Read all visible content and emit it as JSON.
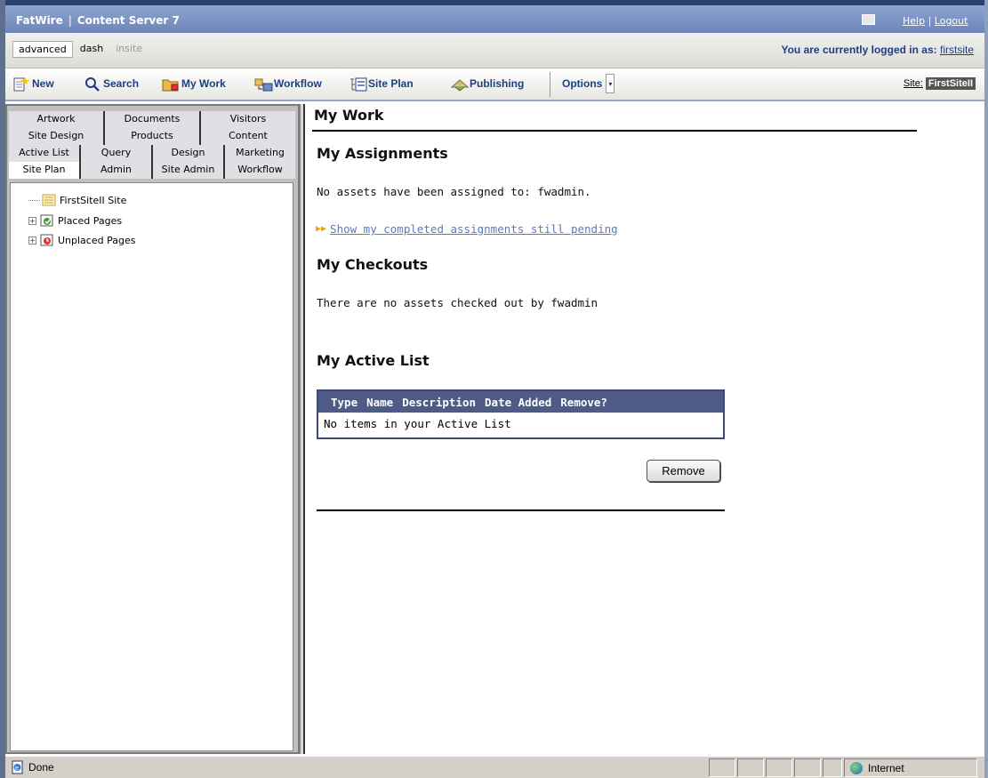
{
  "app": {
    "brand": "FatWire",
    "product": "Content Server 7",
    "help": "Help",
    "logout": "Logout"
  },
  "modes": [
    "advanced",
    "dash",
    "insite"
  ],
  "login": {
    "prefix": "You are currently logged in as:",
    "user": "firstsite"
  },
  "toolbar": {
    "new": "New",
    "search": "Search",
    "my_work": "My Work",
    "workflow": "Workflow",
    "site_plan": "Site Plan",
    "publishing": "Publishing",
    "options": "Options",
    "site_label": "Site:",
    "site_value": "FirstSiteII"
  },
  "left_tabs": [
    [
      "Artwork",
      "Documents",
      "Visitors"
    ],
    [
      "Site Design",
      "Products",
      "Content"
    ],
    [
      "Active List",
      "Query",
      "Design",
      "Marketing"
    ],
    [
      "Site Plan",
      "Admin",
      "Site Admin",
      "Workflow"
    ]
  ],
  "tree": {
    "root": "FirstSiteII Site",
    "placed": "Placed Pages",
    "unplaced": "Unplaced Pages"
  },
  "content": {
    "title": "My Work",
    "assignments_heading": "My Assignments",
    "assignments_text": "No assets have been assigned to: fwadmin.",
    "pending_link": "Show my completed assignments still pending",
    "checkouts_heading": "My Checkouts",
    "checkouts_text": "There are no assets checked out by fwadmin",
    "active_list_heading": "My Active List",
    "table_columns": [
      "Type",
      "Name",
      "Description",
      "Date Added",
      "Remove?"
    ],
    "table_empty": "No items in your Active List",
    "remove_button": "Remove"
  },
  "status": {
    "text": "Done",
    "zone": "Internet"
  },
  "colors": {
    "titlebar": "#7d95c6",
    "link_blue": "#1c3f82",
    "table_header": "#4e5b87"
  }
}
